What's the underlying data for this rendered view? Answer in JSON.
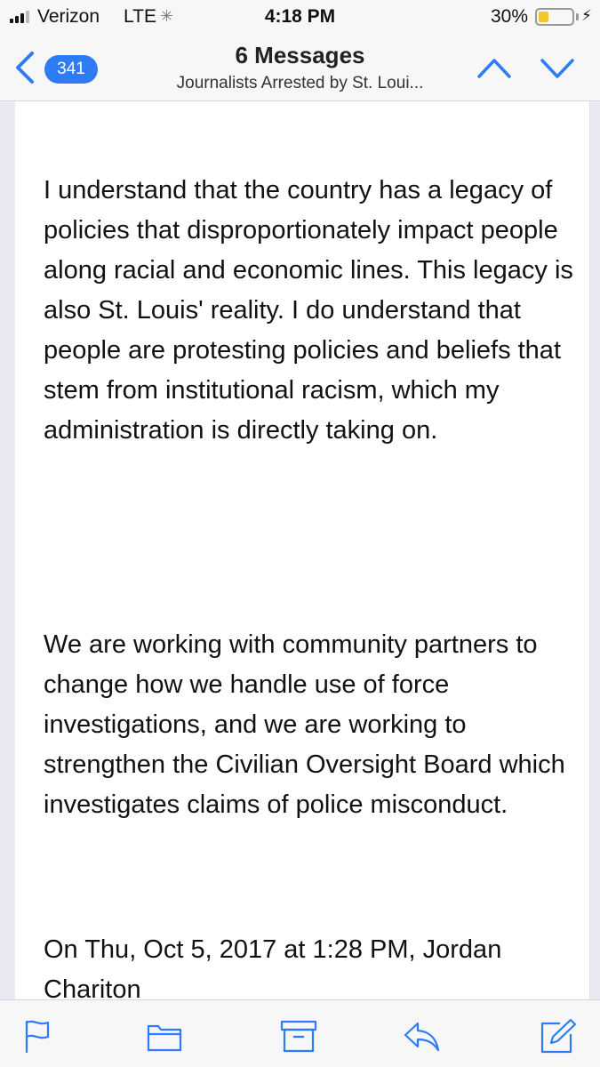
{
  "status_bar": {
    "carrier": "Verizon",
    "network": "LTE",
    "time": "4:18 PM",
    "battery_percent": "30%",
    "battery_level": 0.3,
    "icons": [
      "signal-bars-icon",
      "activity-spinner-icon",
      "battery-icon",
      "charging-bolt-icon"
    ]
  },
  "nav": {
    "back_count": "341",
    "title": "6 Messages",
    "subtitle": "Journalists Arrested by St. Loui...",
    "icons": [
      "back-chevron-icon",
      "chevron-up-icon",
      "chevron-down-icon"
    ]
  },
  "message": {
    "paragraphs": [
      "I understand that the country has a legacy of policies that disproportionately impact people along racial and economic lines. This legacy is also St. Louis' reality. I do understand that people are protesting policies and beliefs that stem from institutional racism, which my administration is directly taking on.",
      "We are working with community partners to change how we handle use of force investigations, and we are working to strengthen the Civilian Oversight Board which investigates claims of police misconduct."
    ],
    "quote_header": "On Thu, Oct 5, 2017 at 1:28 PM, Jordan Chariton"
  },
  "toolbar": {
    "icons": [
      "flag-icon",
      "folder-icon",
      "archive-icon",
      "reply-icon",
      "compose-icon"
    ]
  },
  "colors": {
    "accent": "#2d7cf6",
    "battery_fill": "#f4c430",
    "bar_background": "#f7f7f8"
  }
}
